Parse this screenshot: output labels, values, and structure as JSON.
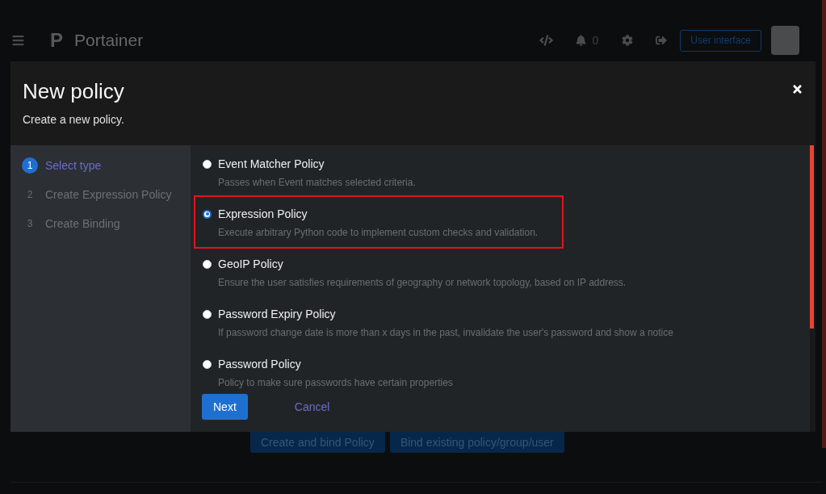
{
  "header": {
    "brand_mark": "P",
    "brand": "Portainer",
    "notifications": "0",
    "user_button": "User interface"
  },
  "page_buttons": [
    "Create and bind Policy",
    "Bind existing policy/group/user"
  ],
  "modal": {
    "title": "New policy",
    "subtitle": "Create a new policy.",
    "steps": [
      {
        "number": "1",
        "label": "Select type",
        "selected": true
      },
      {
        "number": "2",
        "label": "Create Expression Policy",
        "selected": false
      },
      {
        "number": "3",
        "label": "Create Binding",
        "selected": false
      }
    ],
    "options": [
      {
        "label": "Event Matcher Policy",
        "description": "Passes when Event matches selected criteria.",
        "selected": false,
        "highlighted": false
      },
      {
        "label": "Expression Policy",
        "description": "Execute arbitrary Python code to implement custom checks and validation.",
        "selected": true,
        "highlighted": true
      },
      {
        "label": "GeoIP Policy",
        "description": "Ensure the user satisfies requirements of geography or network topology, based on IP address.",
        "selected": false,
        "highlighted": false
      },
      {
        "label": "Password Expiry Policy",
        "description": "If password change date is more than x days in the past, invalidate the user's password and show a notice",
        "selected": false,
        "highlighted": false
      },
      {
        "label": "Password Policy",
        "description": "Policy to make sure passwords have certain properties",
        "selected": false,
        "highlighted": false
      }
    ],
    "footer": {
      "next": "Next",
      "cancel": "Cancel"
    }
  }
}
